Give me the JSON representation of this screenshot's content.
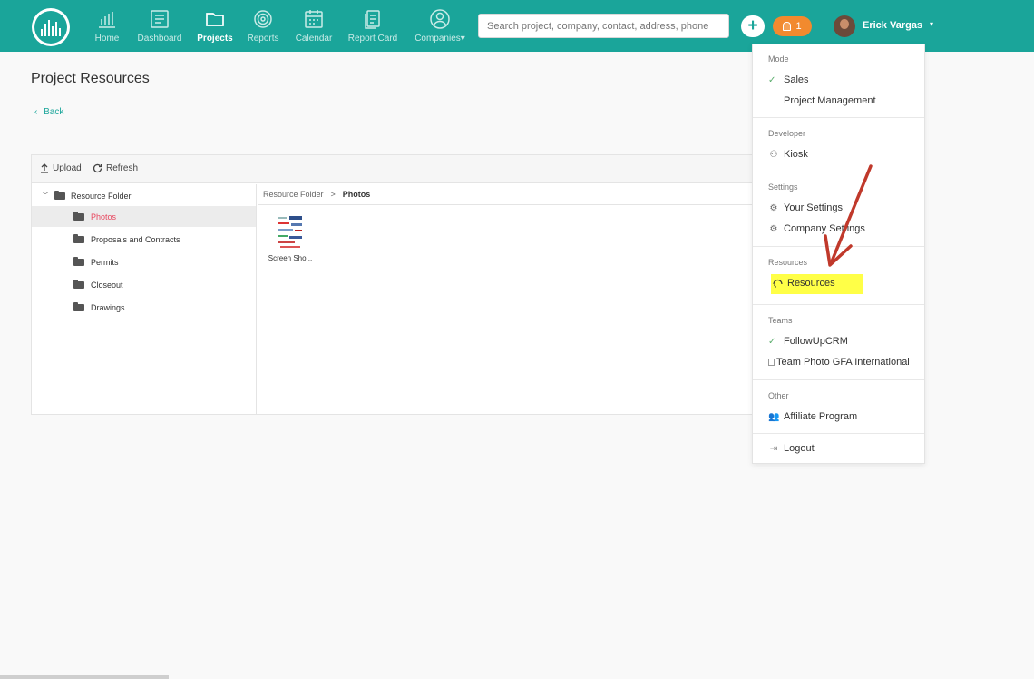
{
  "nav": {
    "items": [
      {
        "label": "Home",
        "icon": "bar-chart-icon"
      },
      {
        "label": "Dashboard",
        "icon": "dashboard-icon"
      },
      {
        "label": "Projects",
        "icon": "folder-icon"
      },
      {
        "label": "Reports",
        "icon": "target-icon"
      },
      {
        "label": "Calendar",
        "icon": "calendar-icon"
      },
      {
        "label": "Report Card",
        "icon": "report-card-icon"
      },
      {
        "label": "Companies",
        "icon": "user-circle-icon"
      }
    ],
    "active_item": "Projects",
    "search_placeholder": "Search project, company, contact, address, phone",
    "plus_label": "+",
    "notification_count": "1",
    "user_name": "Erick Vargas",
    "user_caret": "▾",
    "accent_color": "#1aa59a",
    "notification_color": "#f28a2e"
  },
  "page": {
    "title": "Project Resources",
    "back_label": "Back",
    "back_chevron": "‹"
  },
  "toolbar": {
    "upload_label": "Upload",
    "refresh_label": "Refresh"
  },
  "tree": {
    "root_label": "Resource Folder",
    "folders": [
      "Photos",
      "Proposals and Contracts",
      "Permits",
      "Closeout",
      "Drawings"
    ],
    "selected": "Photos"
  },
  "breadcrumb": {
    "parent": "Resource Folder",
    "separator": ">",
    "current": "Photos"
  },
  "files": [
    {
      "name": "Screen Sho..."
    }
  ],
  "menu": {
    "mode_title": "Mode",
    "mode_items": [
      "Sales",
      "Project Management"
    ],
    "mode_checked": "Sales",
    "developer_title": "Developer",
    "developer_items": [
      "Kiosk"
    ],
    "settings_title": "Settings",
    "settings_items": [
      "Your Settings",
      "Company Settings"
    ],
    "resources_title": "Resources",
    "resources_items": [
      "Resources"
    ],
    "teams_title": "Teams",
    "team_items": [
      "FollowUpCRM",
      "Team Photo GFA International"
    ],
    "other_title": "Other",
    "other_items": [
      "Affiliate Program"
    ],
    "logout_label": "Logout",
    "highlight_color": "#ffff47",
    "annotation_arrow_color": "#c0392b"
  }
}
